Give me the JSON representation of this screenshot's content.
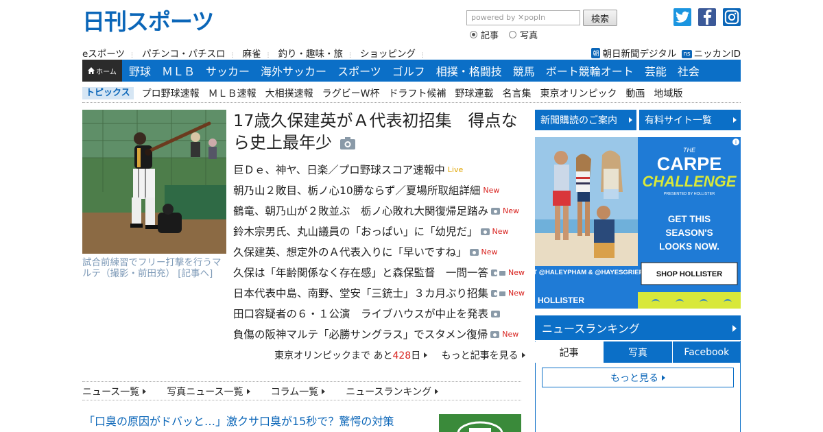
{
  "header": {
    "logo_text": "日刊スポーツ",
    "search_placeholder": "powered by ✕popIn",
    "search_button": "検索",
    "radio_options": [
      {
        "label": "記事",
        "selected": true
      },
      {
        "label": "写真",
        "selected": false
      }
    ],
    "social": [
      {
        "icon": "twitter-icon",
        "color": "#1b95e0"
      },
      {
        "icon": "facebook-icon",
        "color": "#3b5998"
      },
      {
        "icon": "instagram-icon",
        "color": "#0b66b8"
      }
    ]
  },
  "util_nav": {
    "left": [
      "eスポーツ",
      "パチンコ・パチスロ",
      "麻雀",
      "釣り・趣味・旅",
      "ショッピング"
    ],
    "right": [
      {
        "badge": "朝",
        "label": "朝日新聞デジタル"
      },
      {
        "badge": "ns",
        "label": "ニッカンID"
      }
    ]
  },
  "main_nav": {
    "home": "ホーム",
    "items": [
      "野球",
      "ＭＬＢ",
      "サッカー",
      "海外サッカー",
      "スポーツ",
      "ゴルフ",
      "相撲・格闘技",
      "競馬",
      "ボート競輪オート",
      "芸能",
      "社会"
    ]
  },
  "topics": {
    "tag": "トピックス",
    "items": [
      "プロ野球速報",
      "ＭＬＢ速報",
      "大相撲速報",
      "ラグビーW杯",
      "ドラフト候補",
      "野球連載",
      "名言集",
      "東京オリンピック",
      "動画",
      "地域版"
    ]
  },
  "lead": {
    "title": "17歳久保建英がＡ代表初招集　得点なら史上最年少",
    "caption": "試合前練習でフリー打撃を行うマルテ（撮影・前田充） [記事へ]"
  },
  "headlines": [
    {
      "text": "巨Ｄｅ、神ヤ、日楽／プロ野球スコア速報中",
      "tag": "Live",
      "camera": false,
      "video": false
    },
    {
      "text": "朝乃山２敗目、栃ノ心10勝ならず／夏場所取組詳細",
      "tag": "New",
      "camera": false,
      "video": false
    },
    {
      "text": "鶴竜、朝乃山が２敗並ぶ　栃ノ心敗れ大関復帰足踏み",
      "tag": "New",
      "camera": true,
      "video": false
    },
    {
      "text": "鈴木宗男氏、丸山議員の「おっぱい」に「幼児だ」",
      "tag": "New",
      "camera": true,
      "video": false
    },
    {
      "text": "久保建英、想定外のＡ代表入りに「早いですね」",
      "tag": "New",
      "camera": true,
      "video": false
    },
    {
      "text": "久保は「年齢関係なく存在感」と森保監督　一問一答",
      "tag": "New",
      "camera": true,
      "video": true
    },
    {
      "text": "日本代表中島、南野、堂安「三銃士」３カ月ぶり招集",
      "tag": "New",
      "camera": true,
      "video": true
    },
    {
      "text": "田口容疑者の６・１公演　ライブハウスが中止を発表",
      "tag": "",
      "camera": true,
      "video": false
    },
    {
      "text": "負傷の阪神マルテ「必勝サングラス」でスタメン復帰",
      "tag": "New",
      "camera": true,
      "video": false
    }
  ],
  "olympic": {
    "prefix": "東京オリンピックまで あと",
    "days": "428",
    "suffix": "日",
    "more": "もっと記事を見る"
  },
  "list_links": [
    "ニュース一覧",
    "写真ニュース一覧",
    "コラム一覧",
    "ニュースランキング"
  ],
  "pr_link": "「口臭の原因がドバッと…」激クサ口臭が15秒で？驚愕の対策",
  "sidebar": {
    "subscribe": "新聞購読のご案内",
    "paid_sites": "有料サイト一覧",
    "ad": {
      "brand_small": "THE",
      "headline_1": "CARPE",
      "headline_2": "CHALLENGE",
      "presented": "PRESENTED BY HOLLISTER",
      "body": "GET THIS SEASON'S LOOKS NOW.",
      "ft": "FT @HALEYPHAM & @HAYESGRIER",
      "cta": "SHOP HOLLISTER",
      "footer": "HOLLISTER"
    },
    "ranking": {
      "title": "ニュースランキング",
      "tabs": [
        "記事",
        "写真",
        "Facebook"
      ],
      "more": "もっと見る"
    }
  },
  "colors": {
    "brand_blue": "#0b6fc7",
    "new_red": "#d8231f",
    "live_yellow": "#e0a400",
    "caption_blue": "#7f9bb8"
  }
}
